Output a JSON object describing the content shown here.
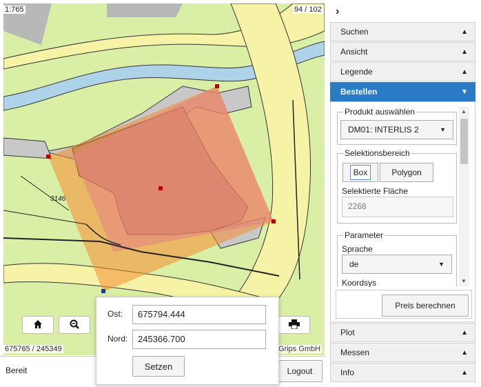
{
  "map": {
    "scale": "1:765",
    "page_count": "94 / 102",
    "coord_readout": "675765 / 245349",
    "copyright": "Grips GmbH",
    "parcel_label": "3146"
  },
  "popup": {
    "ost_label": "Ost:",
    "ost_value": "675794.444",
    "nord_label": "Nord:",
    "nord_value": "245366.700",
    "set_label": "Setzen"
  },
  "status": {
    "text": "Bereit",
    "logout": "Logout"
  },
  "sidebar": {
    "collapse_icon": "chevron-right-icon",
    "items": [
      {
        "label": "Suchen"
      },
      {
        "label": "Ansicht"
      },
      {
        "label": "Legende"
      },
      {
        "label": "Bestellen"
      },
      {
        "label": "Plot"
      },
      {
        "label": "Messen"
      },
      {
        "label": "Info"
      }
    ],
    "active_color": "#2a7ac5"
  },
  "order": {
    "product_legend": "Produkt auswählen",
    "product_value": "DM01: INTERLIS 2",
    "selection_legend": "Selektionsbereich",
    "box_label": "Box",
    "polygon_label": "Polygon",
    "area_label": "Selektierte Fläche",
    "area_value": "2268",
    "param_legend": "Parameter",
    "lang_label": "Sprache",
    "lang_value": "de",
    "coord_label": "Koordsys",
    "price_button": "Preis berechnen"
  }
}
